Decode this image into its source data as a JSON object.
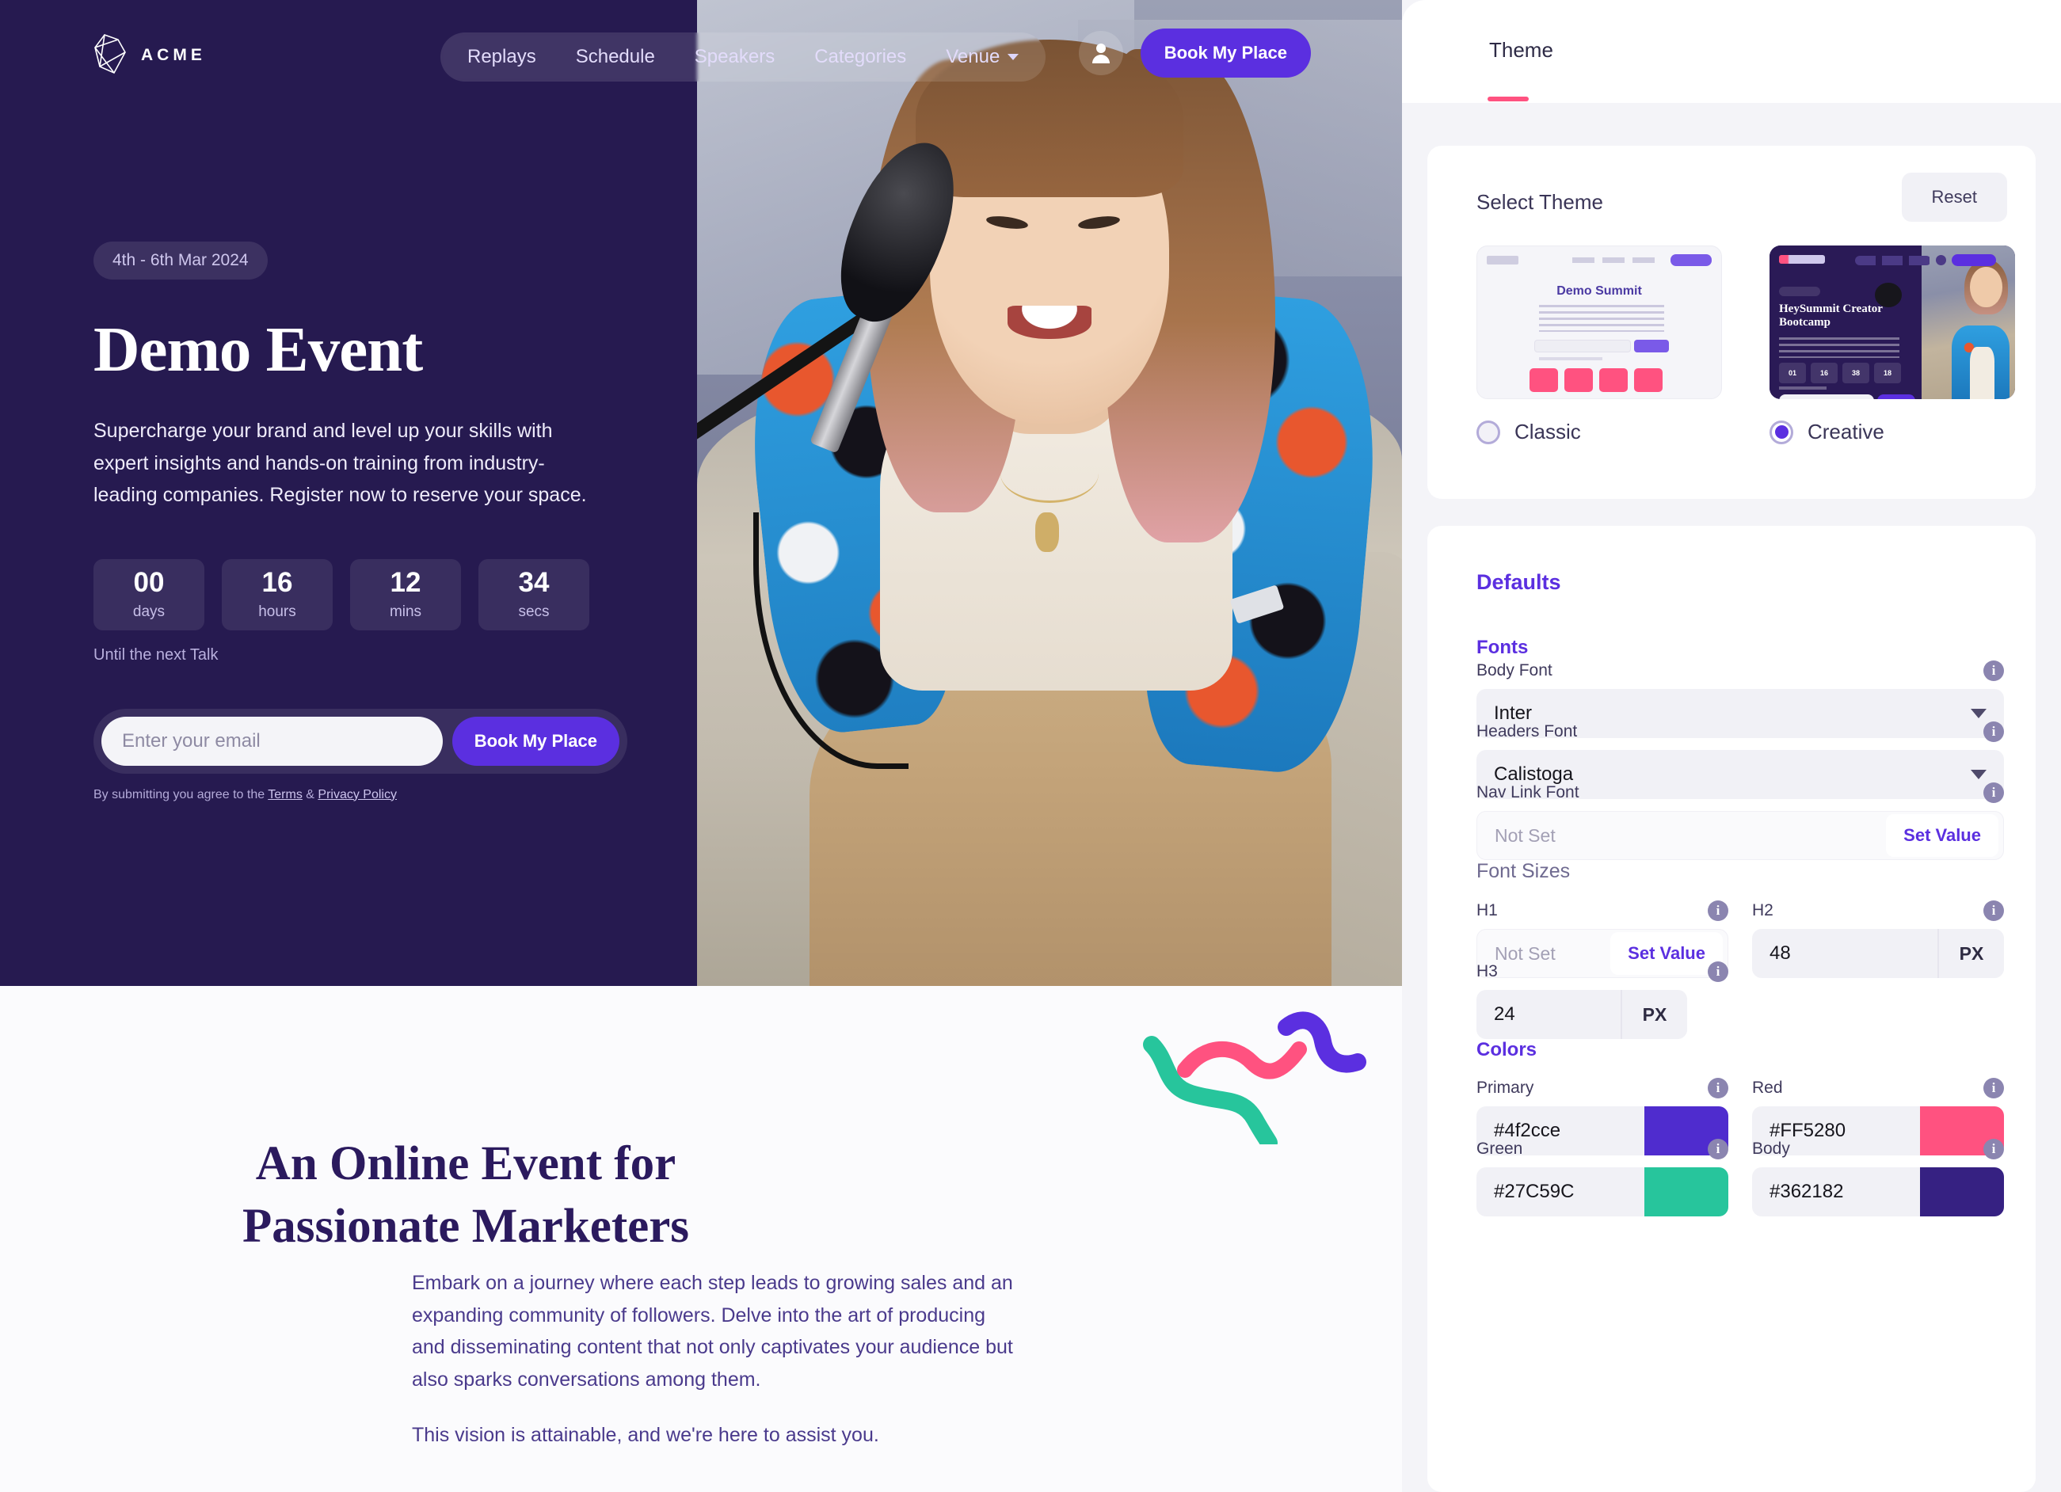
{
  "preview": {
    "brand": {
      "name": "ACME",
      "logo_icon": "gem-logo-icon"
    },
    "nav": {
      "links": [
        {
          "label": "Replays"
        },
        {
          "label": "Schedule"
        },
        {
          "label": "Speakers"
        },
        {
          "label": "Categories"
        },
        {
          "label": "Venue",
          "caret": true
        }
      ],
      "account_icon": "user-avatar-icon",
      "cta_label": "Book My Place"
    },
    "hero": {
      "date_chip": "4th - 6th Mar 2024",
      "title": "Demo Event",
      "subtitle": "Supercharge your brand and level up your skills with expert insights and hands-on training from industry-leading companies. Register now to reserve your space.",
      "countdown": [
        {
          "value": "00",
          "label": "days"
        },
        {
          "value": "16",
          "label": "hours"
        },
        {
          "value": "12",
          "label": "mins"
        },
        {
          "value": "34",
          "label": "secs"
        }
      ],
      "countdown_note": "Until the next Talk",
      "email_placeholder": "Enter your email",
      "email_value": "",
      "form_cta": "Book My Place",
      "terms_prefix": "By submitting you agree to the ",
      "terms_link": "Terms",
      "terms_amp": " & ",
      "privacy_link": "Privacy Policy"
    },
    "section": {
      "title_line1": "An Online Event for",
      "title_line2": "Passionate Marketers",
      "paragraph1": "Embark on a journey where each step leads to growing sales and an expanding community of followers. Delve into the art of producing and disseminating content that not only captivates your audience but also sparks conversations among them.",
      "paragraph2": "This vision is attainable, and we're here to assist you."
    },
    "decoration": {
      "squiggle_green": "#27C59C",
      "squiggle_pink": "#FF5280",
      "squiggle_purple": "#5B2FE0"
    }
  },
  "panel": {
    "tab_label": "Theme",
    "tab_accent": "#FF5280",
    "theme_card": {
      "title": "Select Theme",
      "reset_label": "Reset",
      "options": [
        {
          "label": "Classic",
          "selected": false,
          "thumb_title": "Demo Summit"
        },
        {
          "label": "Creative",
          "selected": true,
          "thumb_title": "HeySummit Creator Bootcamp"
        }
      ]
    },
    "defaults": {
      "heading": "Defaults",
      "fonts_heading": "Fonts",
      "body_font": {
        "label": "Body Font",
        "value": "Inter",
        "info_icon": "info-icon"
      },
      "headers_font": {
        "label": "Headers Font",
        "value": "Calistoga",
        "info_icon": "info-icon"
      },
      "nav_link_font": {
        "label": "Nav Link Font",
        "value": "Not Set",
        "action": "Set Value",
        "info_icon": "info-icon"
      },
      "font_sizes_heading": "Font Sizes",
      "h1": {
        "label": "H1",
        "value": "Not Set",
        "action": "Set Value",
        "info_icon": "info-icon"
      },
      "h2": {
        "label": "H2",
        "value": "48",
        "unit": "PX",
        "info_icon": "info-icon"
      },
      "h3": {
        "label": "H3",
        "value": "24",
        "unit": "PX",
        "info_icon": "info-icon"
      },
      "colors_heading": "Colors",
      "primary": {
        "label": "Primary",
        "value": "#4f2cce",
        "swatch": "#4f2cce",
        "info_icon": "info-icon"
      },
      "red": {
        "label": "Red",
        "value": "#FF5280",
        "swatch": "#FF5280",
        "info_icon": "info-icon"
      },
      "green": {
        "label": "Green",
        "value": "#27C59C",
        "swatch": "#27C59C",
        "info_icon": "info-icon"
      },
      "body_color": {
        "label": "Body",
        "value": "#362182",
        "swatch": "#362182",
        "info_icon": "info-icon"
      }
    }
  }
}
